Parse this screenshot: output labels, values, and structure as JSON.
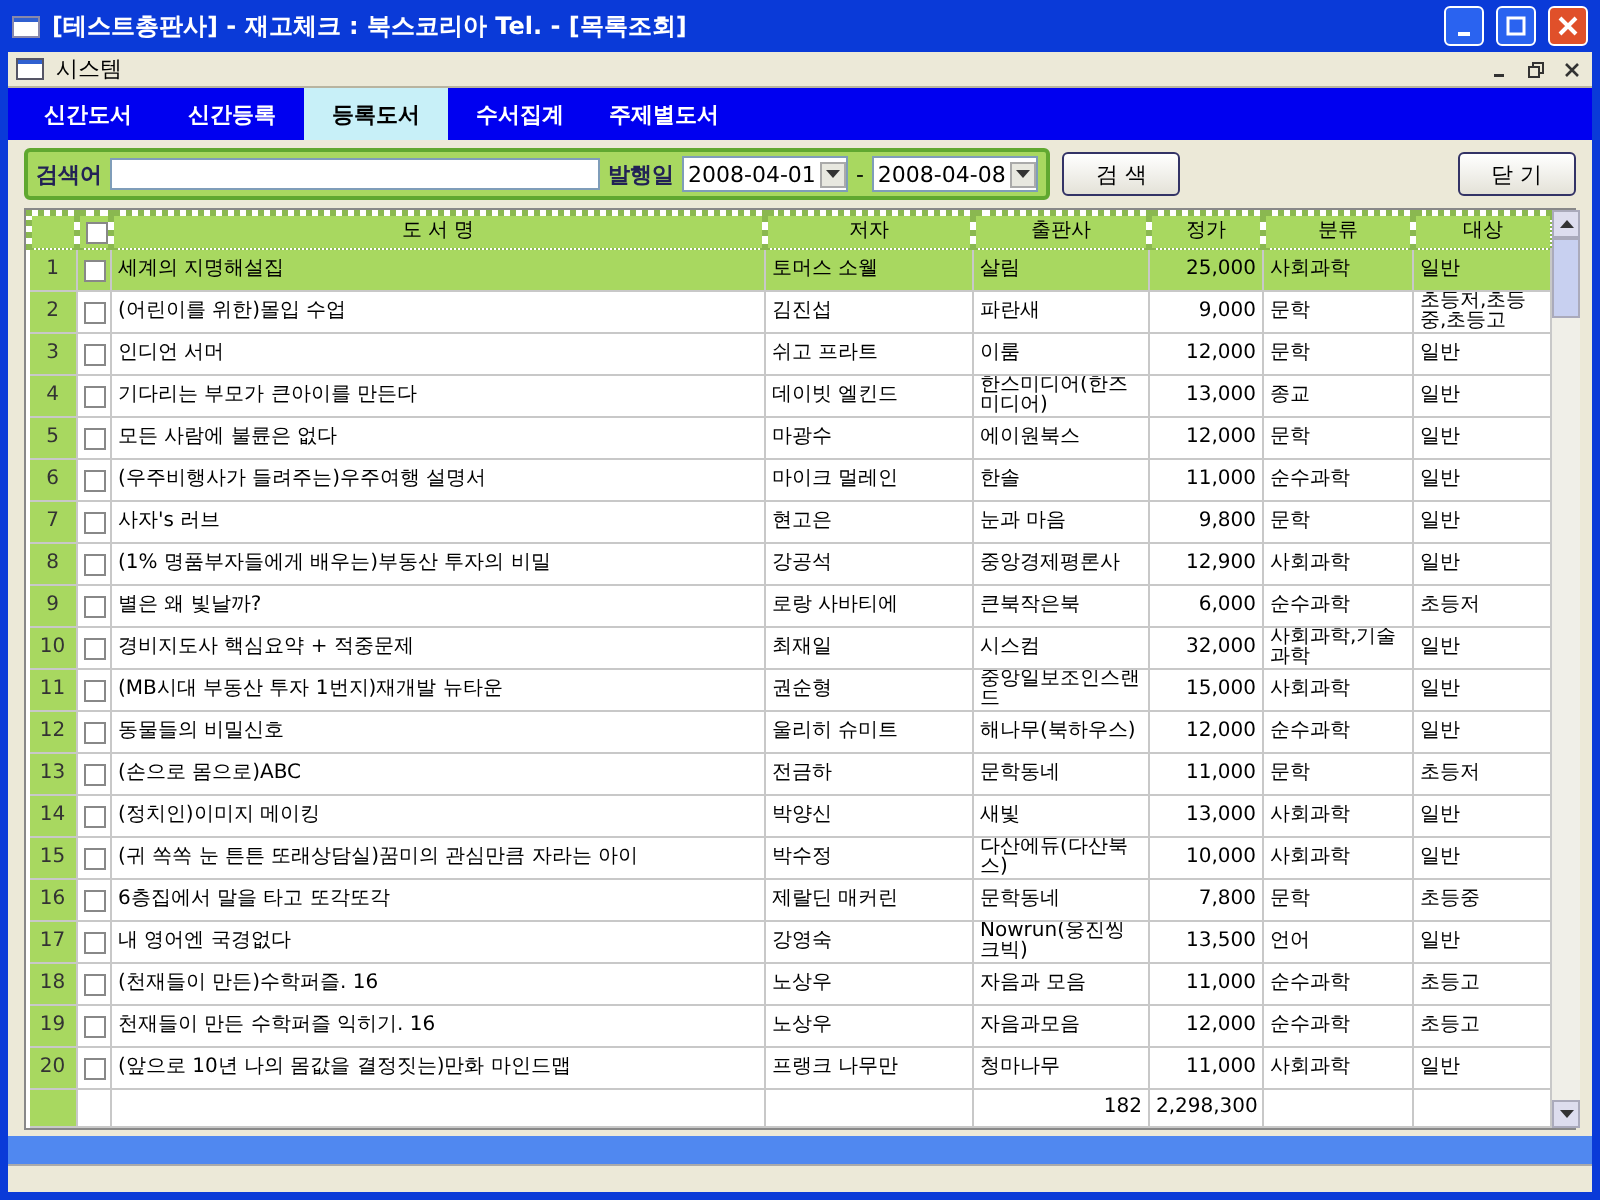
{
  "window": {
    "title": "[테스트총판사] - 재고체크 : 북스코리아  Tel. - [목록조회]"
  },
  "menu_bar": {
    "label": "시스템"
  },
  "tabs": [
    {
      "label": "신간도서",
      "selected": false
    },
    {
      "label": "신간등록",
      "selected": false
    },
    {
      "label": "등록도서",
      "selected": true
    },
    {
      "label": "수서집계",
      "selected": false
    },
    {
      "label": "주제별도서",
      "selected": false
    }
  ],
  "search": {
    "label": "검색어"
  },
  "date_range": {
    "label": "발행일",
    "from": "2008-04-01",
    "separator": "-",
    "to": "2008-04-08"
  },
  "buttons": {
    "search": "검 색",
    "close": "닫 기"
  },
  "table": {
    "header_checked": false,
    "columns": [
      "도 서 명",
      "저자",
      "출판사",
      "정가",
      "분류",
      "대상"
    ],
    "rows": [
      {
        "no": "1",
        "checked": false,
        "selected": true,
        "cells": [
          "세계의 지명해설집",
          "토머스 소웰",
          "살림",
          "25,000",
          "사회과학",
          "일반"
        ]
      },
      {
        "no": "2",
        "checked": false,
        "selected": false,
        "cells": [
          "(어린이를 위한)몰입 수업",
          "김진섭",
          "파란새",
          "9,000",
          "문학",
          "초등저,초등중,초등고"
        ]
      },
      {
        "no": "3",
        "checked": false,
        "selected": false,
        "cells": [
          "인디언 서머",
          "쉬고 프라트",
          "이룸",
          "12,000",
          "문학",
          "일반"
        ]
      },
      {
        "no": "4",
        "checked": false,
        "selected": false,
        "cells": [
          "기다리는 부모가 큰아이를 만든다",
          "데이빗 엘킨드",
          "한스미디어(한즈미디어)",
          "13,000",
          "종교",
          "일반"
        ]
      },
      {
        "no": "5",
        "checked": false,
        "selected": false,
        "cells": [
          "모든 사람에 불륜은 없다",
          "마광수",
          "에이원북스",
          "12,000",
          "문학",
          "일반"
        ]
      },
      {
        "no": "6",
        "checked": false,
        "selected": false,
        "cells": [
          "(우주비행사가 들려주는)우주여행 설명서",
          "마이크 멀레인",
          "한솔",
          "11,000",
          "순수과학",
          "일반"
        ]
      },
      {
        "no": "7",
        "checked": false,
        "selected": false,
        "cells": [
          "사자's 러브",
          "현고은",
          "눈과 마음",
          "9,800",
          "문학",
          "일반"
        ]
      },
      {
        "no": "8",
        "checked": false,
        "selected": false,
        "cells": [
          "(1% 명품부자들에게 배우는)부동산 투자의 비밀",
          "강공석",
          "중앙경제평론사",
          "12,900",
          "사회과학",
          "일반"
        ]
      },
      {
        "no": "9",
        "checked": false,
        "selected": false,
        "cells": [
          "별은 왜 빛날까?",
          "로랑 사바티에",
          "큰북작은북",
          "6,000",
          "순수과학",
          "초등저"
        ]
      },
      {
        "no": "10",
        "checked": false,
        "selected": false,
        "cells": [
          "경비지도사 핵심요약 + 적중문제",
          "최재일",
          "시스컴",
          "32,000",
          "사회과학,기술과학",
          "일반"
        ]
      },
      {
        "no": "11",
        "checked": false,
        "selected": false,
        "cells": [
          "(MB시대 부동산 투자 1번지)재개발 뉴타운",
          "권순형",
          "중앙일보조인스랜드",
          "15,000",
          "사회과학",
          "일반"
        ]
      },
      {
        "no": "12",
        "checked": false,
        "selected": false,
        "cells": [
          "동물들의 비밀신호",
          "울리히 슈미트",
          "해나무(북하우스)",
          "12,000",
          "순수과학",
          "일반"
        ]
      },
      {
        "no": "13",
        "checked": false,
        "selected": false,
        "cells": [
          "(손으로 몸으로)ABC",
          "전금하",
          "문학동네",
          "11,000",
          "문학",
          "초등저"
        ]
      },
      {
        "no": "14",
        "checked": false,
        "selected": false,
        "cells": [
          "(정치인)이미지 메이킹",
          "박양신",
          "새빛",
          "13,000",
          "사회과학",
          "일반"
        ]
      },
      {
        "no": "15",
        "checked": false,
        "selected": false,
        "cells": [
          "(귀 쏙쏙 눈 튼튼 또래상담실)꿈미의 관심만큼 자라는 아이",
          "박수정",
          "다산에듀(다산북스)",
          "10,000",
          "사회과학",
          "일반"
        ]
      },
      {
        "no": "16",
        "checked": false,
        "selected": false,
        "cells": [
          "6층집에서 말을 타고 또각또각",
          "제랄딘 매커린",
          "문학동네",
          "7,800",
          "문학",
          "초등중"
        ]
      },
      {
        "no": "17",
        "checked": false,
        "selected": false,
        "cells": [
          "내 영어엔 국경없다",
          "강영숙",
          "Nowrun(웅진씽크빅)",
          "13,500",
          "언어",
          "일반"
        ]
      },
      {
        "no": "18",
        "checked": false,
        "selected": false,
        "cells": [
          "(천재들이 만든)수학퍼즐. 16",
          "노상우",
          "자음과 모음",
          "11,000",
          "순수과학",
          "초등고"
        ]
      },
      {
        "no": "19",
        "checked": false,
        "selected": false,
        "cells": [
          "천재들이 만든 수학퍼즐 익히기. 16",
          "노상우",
          "자음과모음",
          "12,000",
          "순수과학",
          "초등고"
        ]
      },
      {
        "no": "20",
        "checked": false,
        "selected": false,
        "cells": [
          "(앞으로 10년 나의 몸값을 결정짓는)만화 마인드맵",
          "프랭크 나무만",
          "청마나무",
          "11,000",
          "사회과학",
          "일반"
        ]
      }
    ],
    "totals": {
      "count": "182",
      "price": "2,298,300"
    }
  }
}
